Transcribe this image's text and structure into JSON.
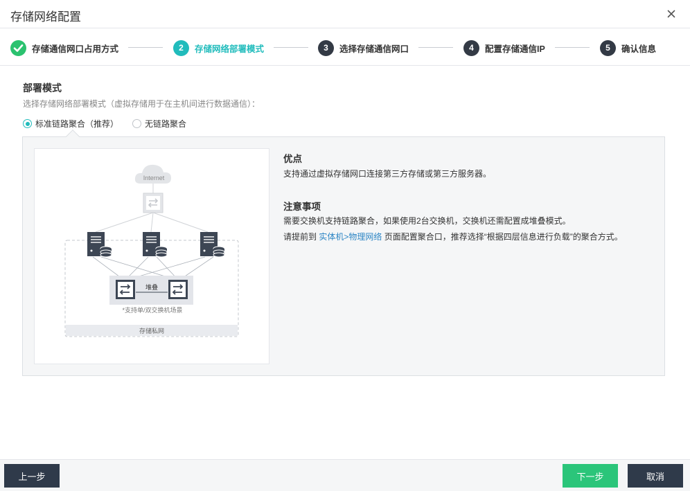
{
  "dialog": {
    "title": "存储网络配置"
  },
  "steps": [
    {
      "number": "1",
      "label": "存储通信网口占用方式",
      "state": "done"
    },
    {
      "number": "2",
      "label": "存储网络部署模式",
      "state": "active"
    },
    {
      "number": "3",
      "label": "选择存储通信网口",
      "state": "todo"
    },
    {
      "number": "4",
      "label": "配置存储通信IP",
      "state": "todo"
    },
    {
      "number": "5",
      "label": "确认信息",
      "state": "todo"
    }
  ],
  "mode": {
    "title": "部署模式",
    "description": "选择存储网络部署模式（虚拟存储用于在主机间进行数据通信）：",
    "options": [
      {
        "label": "标准链路聚合（推荐）",
        "checked": true
      },
      {
        "label": "无链路聚合",
        "checked": false
      }
    ]
  },
  "diagram": {
    "internet_label": "Internet",
    "stack_label": "堆叠",
    "support_note": "*支持单/双交换机场景",
    "private_network_label": "存储私网"
  },
  "info": {
    "advantages_title": "优点",
    "advantages_text": "支持通过虚拟存储网口连接第三方存储或第三方服务器。",
    "notes_title": "注意事项",
    "notes_line1": "需要交换机支持链路聚合，如果使用2台交换机，交换机还需配置成堆叠模式。",
    "notes_line2_prefix": "请提前到 ",
    "notes_line2_link": "实体机>物理网络",
    "notes_line2_suffix": " 页面配置聚合口，推荐选择“根据四层信息进行负载”的聚合方式。"
  },
  "footer": {
    "prev_label": "上一步",
    "next_label": "下一步",
    "cancel_label": "取消"
  },
  "colors": {
    "accent": "#21bcbc",
    "done": "#2bc26f",
    "dark": "#2f3a4a",
    "primary_button": "#2bc57a",
    "link": "#2d86c5"
  }
}
